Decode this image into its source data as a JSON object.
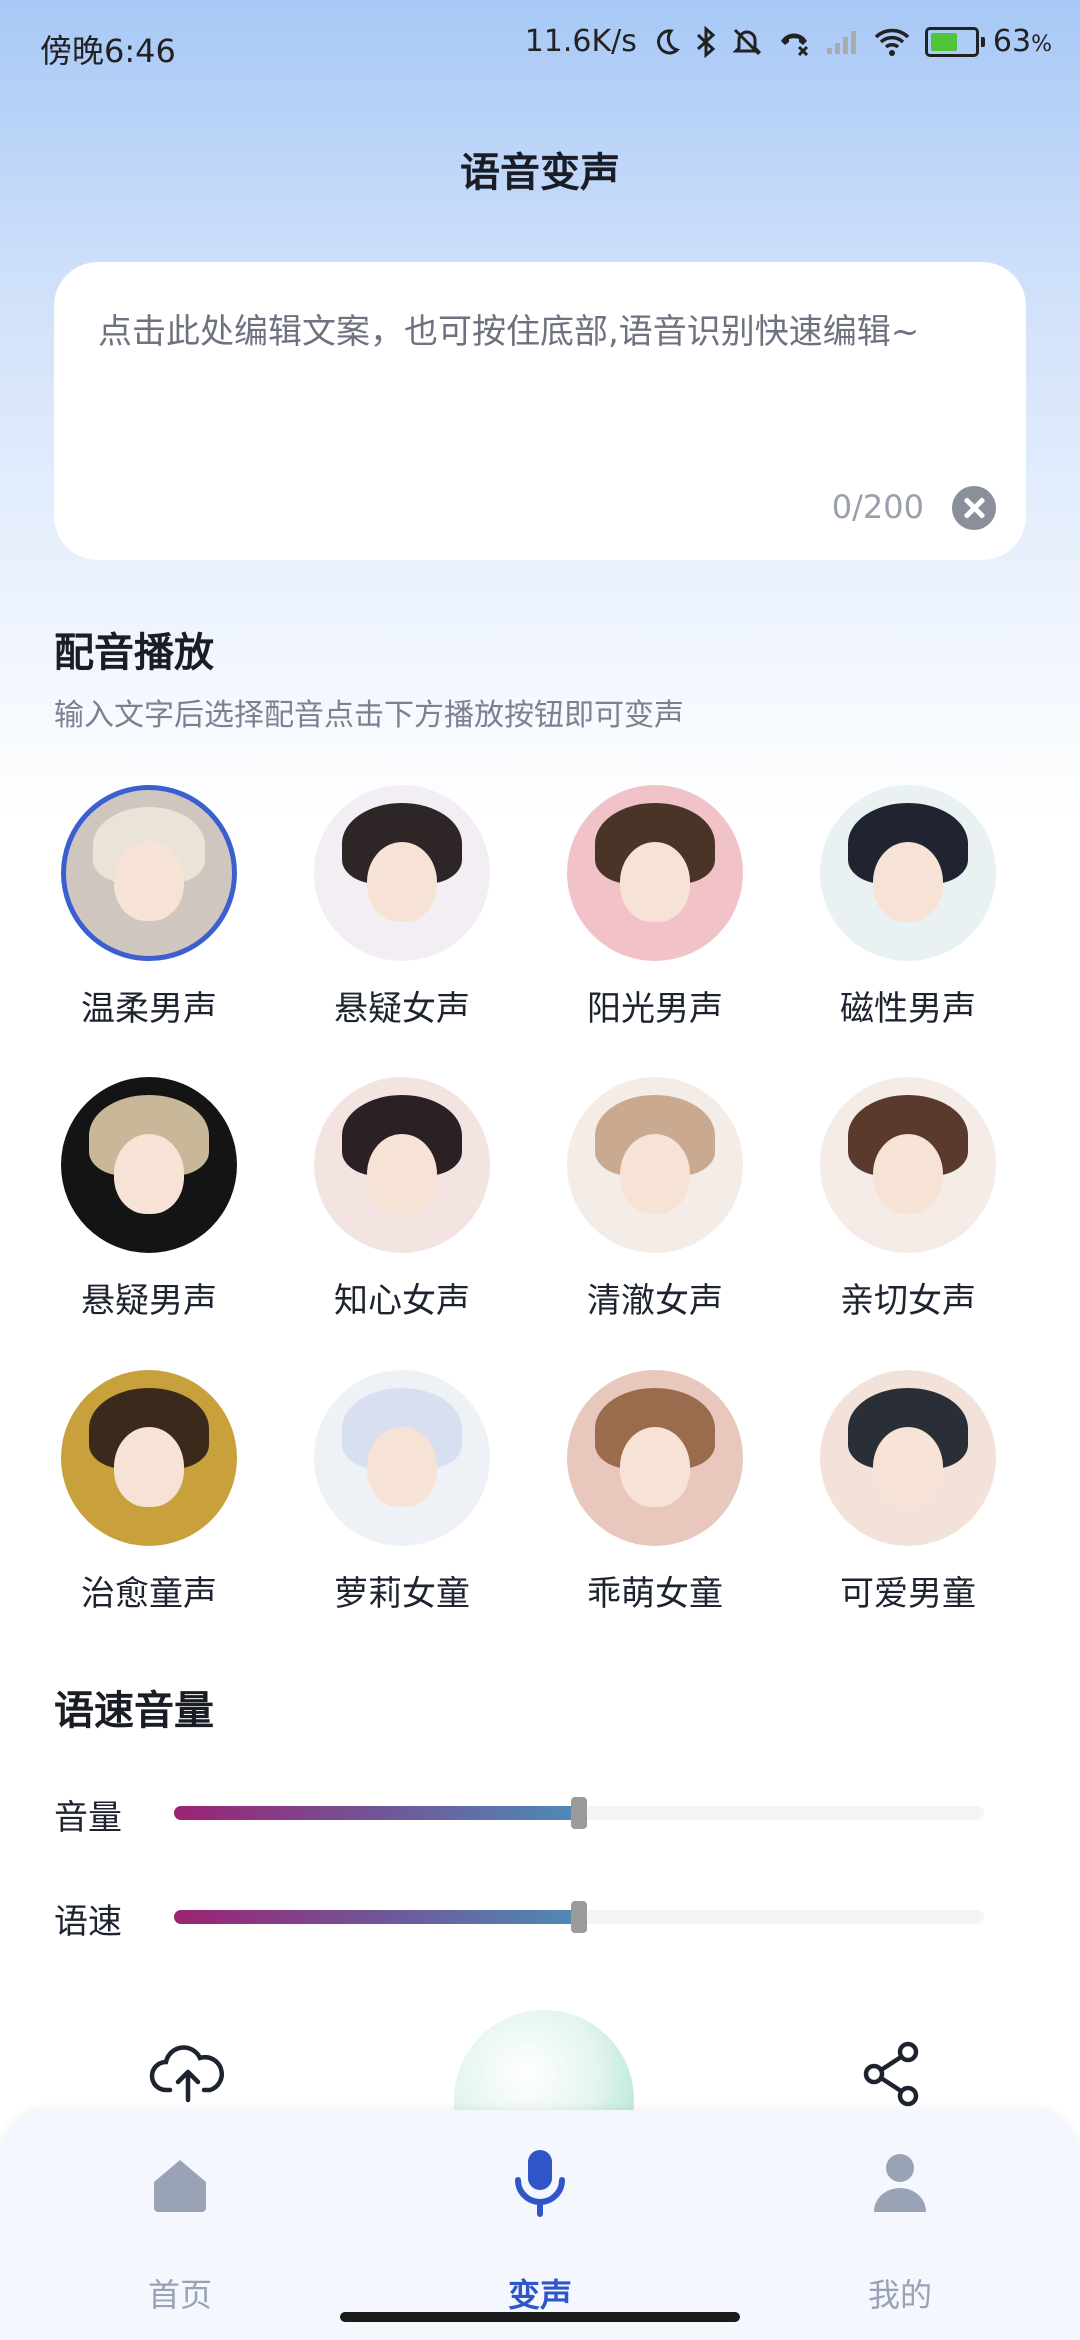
{
  "status_bar": {
    "time": "傍晚6:46",
    "network_speed": "11.6K/s",
    "battery_percent": "63",
    "battery_unit": "%",
    "battery_level": 0.63,
    "icons": [
      "moon-icon",
      "bluetooth-icon",
      "bell-muted-icon",
      "call-icon",
      "signal-icon",
      "wifi-icon",
      "battery-charging-icon"
    ]
  },
  "header": {
    "title": "语音变声"
  },
  "editor": {
    "placeholder": "点击此处编辑文案，也可按住底部,语音识别快速编辑~",
    "counter": "0/200"
  },
  "dubbing": {
    "title": "配音播放",
    "subtitle": "输入文字后选择配音点击下方播放按钮即可变声",
    "voices": [
      {
        "label": "温柔男声",
        "selected": true,
        "bg": "#cfc6bf",
        "hair": "#e9e3d8"
      },
      {
        "label": "悬疑女声",
        "selected": false,
        "bg": "#f3eef3",
        "hair": "#2e2626"
      },
      {
        "label": "阳光男声",
        "selected": false,
        "bg": "#f1c3c9",
        "hair": "#4a3428"
      },
      {
        "label": "磁性男声",
        "selected": false,
        "bg": "#e9f1f3",
        "hair": "#1f2430"
      },
      {
        "label": "悬疑男声",
        "selected": false,
        "bg": "#141414",
        "hair": "#c9b79a"
      },
      {
        "label": "知心女声",
        "selected": false,
        "bg": "#f3e4e2",
        "hair": "#2b2024"
      },
      {
        "label": "清澈女声",
        "selected": false,
        "bg": "#f4ece6",
        "hair": "#c9a98f"
      },
      {
        "label": "亲切女声",
        "selected": false,
        "bg": "#f6ece7",
        "hair": "#5a3a2c"
      },
      {
        "label": "治愈童声",
        "selected": false,
        "bg": "#c9a13c",
        "hair": "#3b2a1c"
      },
      {
        "label": "萝莉女童",
        "selected": false,
        "bg": "#eef1f6",
        "hair": "#d8dff0"
      },
      {
        "label": "乖萌女童",
        "selected": false,
        "bg": "#e8c8bd",
        "hair": "#9b6b4d"
      },
      {
        "label": "可爱男童",
        "selected": false,
        "bg": "#f3e2da",
        "hair": "#2a2e36"
      }
    ]
  },
  "speed_volume": {
    "title": "语速音量",
    "volume_label": "音量",
    "volume_value": 0.5,
    "speed_label": "语速",
    "speed_value": 0.5
  },
  "actions": {
    "upload_icon": "cloud-upload-icon",
    "share_icon": "share-icon"
  },
  "tabbar": {
    "tabs": [
      {
        "label": "首页",
        "icon": "home-icon",
        "active": false
      },
      {
        "label": "变声",
        "icon": "microphone-icon",
        "active": true
      },
      {
        "label": "我的",
        "icon": "person-icon",
        "active": false
      }
    ],
    "active_color": "#2f55c9",
    "inactive_color": "#9aa3b5"
  }
}
